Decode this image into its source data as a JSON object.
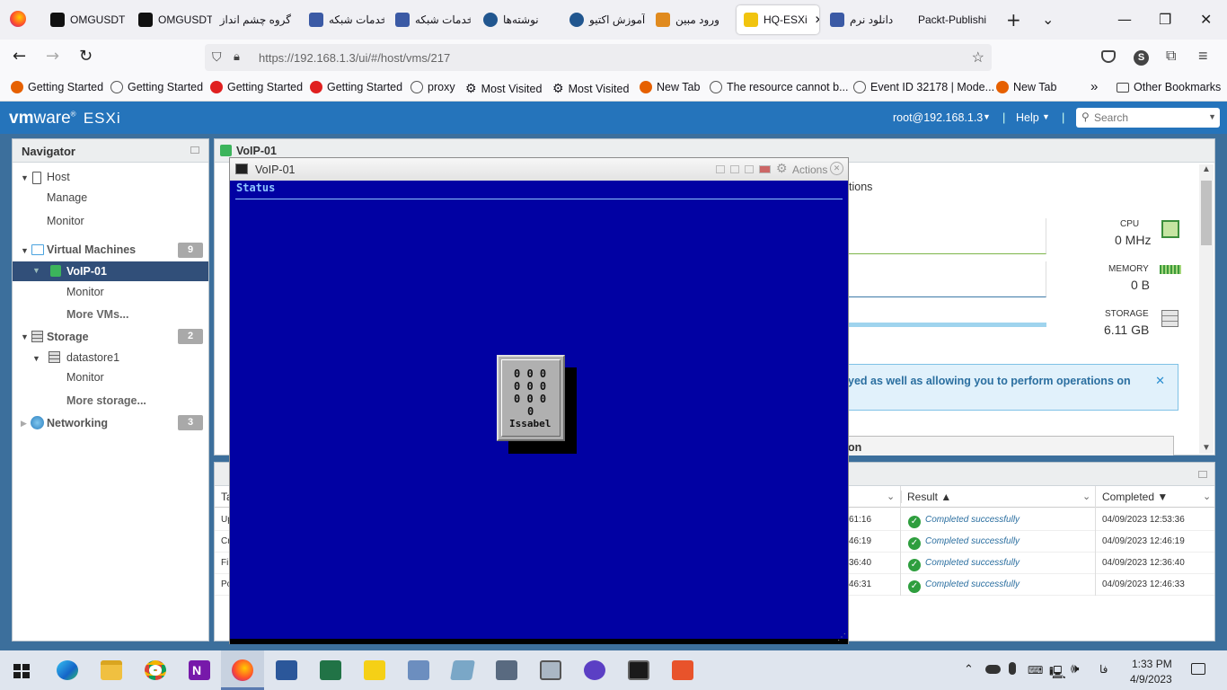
{
  "browser": {
    "tabs": [
      {
        "label": "OMGUSDT"
      },
      {
        "label": "OMGUSDT"
      },
      {
        "label": "گروه چشم انداز"
      },
      {
        "label": "خدمات شبکه"
      },
      {
        "label": "خدمات شبکه"
      },
      {
        "label": "نوشته‌ها"
      },
      {
        "label": "آموزش اکتیو"
      },
      {
        "label": "ورود مبین"
      },
      {
        "label": "HQ-ESXi"
      },
      {
        "label": "دانلود نرم"
      },
      {
        "label": "Packt-Publishi"
      }
    ],
    "url": "https://192.168.1.3/ui/#/host/vms/217",
    "profile_initial": "S",
    "bookmarks": [
      {
        "label": "Getting Started",
        "color": "#e66000"
      },
      {
        "label": "Getting Started",
        "color": "#555555"
      },
      {
        "label": "Getting Started",
        "color": "#e02020"
      },
      {
        "label": "Getting Started",
        "color": "#e02020"
      },
      {
        "label": "proxy",
        "color": "#555555"
      },
      {
        "label": "Most Visited",
        "color": "#555555"
      },
      {
        "label": "Most Visited",
        "color": "#555555"
      },
      {
        "label": "New Tab",
        "color": "#e66000"
      },
      {
        "label": "The resource cannot b...",
        "color": "#555555"
      },
      {
        "label": "Event ID 32178 | Mode...",
        "color": "#555555"
      },
      {
        "label": "New Tab",
        "color": "#e66000"
      }
    ],
    "other_bookmarks": "Other Bookmarks"
  },
  "esxi": {
    "brand_vm": "vm",
    "brand_ware": "ware",
    "brand_product": "ESXi",
    "user": "root@192.168.1.3",
    "help": "Help",
    "search_placeholder": "Search",
    "navigator": {
      "title": "Navigator",
      "host": "Host",
      "manage": "Manage",
      "monitor": "Monitor",
      "vms": "Virtual Machines",
      "vms_count": "9",
      "vm_selected": "VoIP-01",
      "vm_monitor": "Monitor",
      "more_vms": "More VMs...",
      "storage": "Storage",
      "storage_count": "2",
      "datastore": "datastore1",
      "ds_monitor": "Monitor",
      "more_storage": "More storage...",
      "networking": "Networking",
      "net_count": "3"
    },
    "main": {
      "title": "VoIP-01",
      "actions_partial": "tions",
      "cpu_label": "CPU",
      "cpu_value": "0 MHz",
      "mem_label": "MEMORY",
      "mem_value": "0 B",
      "storage_label": "STORAGE",
      "storage_value": "6.11 GB",
      "info_text": "yed as well as allowing you to perform operations on",
      "section_partial": "on"
    },
    "tasks": {
      "col_task_partial": "Ta",
      "col_result": "Result ▲",
      "col_completed": "Completed ▼",
      "rows": [
        {
          "task": "Up",
          "time": "61:16",
          "result": "Completed successfully",
          "completed": "04/09/2023 12:53:36"
        },
        {
          "task": "Cr",
          "time": "46:19",
          "result": "Completed successfully",
          "completed": "04/09/2023 12:46:19"
        },
        {
          "task": "Fi",
          "time": "36:40",
          "result": "Completed successfully",
          "completed": "04/09/2023 12:36:40"
        },
        {
          "task": "Po",
          "time": "46:31",
          "result": "Completed successfully",
          "completed": "04/09/2023 12:46:33"
        }
      ]
    },
    "console": {
      "title": "VoIP-01",
      "actions": "Actions",
      "status": "Status",
      "logo_rows": [
        "0 0 0",
        "0 0 0",
        "0 0 0",
        "0"
      ],
      "logo_name": "Issabel"
    }
  },
  "taskbar": {
    "time": "1:33 PM",
    "date": "4/9/2023",
    "lang": "فا"
  }
}
